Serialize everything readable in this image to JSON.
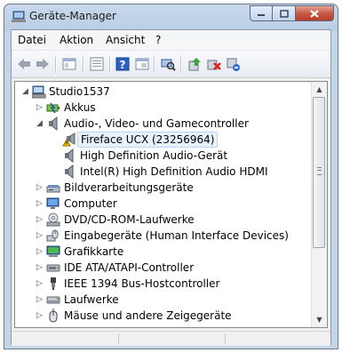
{
  "window": {
    "title": "Geräte-Manager",
    "app_icon": "device-manager-icon"
  },
  "caption_buttons": [
    "minimize-icon",
    "maximize-icon",
    "close-icon"
  ],
  "menu": [
    "Datei",
    "Aktion",
    "Ansicht",
    "?"
  ],
  "toolbar": [
    "back-arrow-icon",
    "forward-arrow-icon",
    "show-hide-console-tree-icon",
    "properties-icon",
    "help-icon",
    "show-hidden-icon",
    "scan-hardware-icon",
    "update-driver-icon",
    "uninstall-icon",
    "disable-icon"
  ],
  "tree": {
    "root": "Studio1537",
    "items": [
      {
        "label": "Akkus",
        "icon": "battery-icon",
        "expanded": false
      },
      {
        "label": "Audio-, Video- und Gamecontroller",
        "icon": "speaker-icon",
        "expanded": true,
        "children": [
          {
            "label": "Fireface UCX (23256964)",
            "icon": "warning-speaker-icon",
            "selected": true
          },
          {
            "label": "High Definition Audio-Gerät",
            "icon": "speaker-icon"
          },
          {
            "label": "Intel(R) High Definition Audio HDMI",
            "icon": "speaker-icon"
          }
        ]
      },
      {
        "label": "Bildverarbeitungsgeräte",
        "icon": "scanner-icon",
        "expanded": false
      },
      {
        "label": "Computer",
        "icon": "computer-icon",
        "expanded": false
      },
      {
        "label": "DVD/CD-ROM-Laufwerke",
        "icon": "disc-drive-icon",
        "expanded": false
      },
      {
        "label": "Eingabegeräte (Human Interface Devices)",
        "icon": "hid-icon",
        "expanded": false
      },
      {
        "label": "Grafikkarte",
        "icon": "display-adapter-icon",
        "expanded": false
      },
      {
        "label": "IDE ATA/ATAPI-Controller",
        "icon": "ide-controller-icon",
        "expanded": false
      },
      {
        "label": "IEEE 1394 Bus-Hostcontroller",
        "icon": "firewire-icon",
        "expanded": false
      },
      {
        "label": "Laufwerke",
        "icon": "disk-drive-icon",
        "expanded": false
      },
      {
        "label": "Mäuse und andere Zeigegeräte",
        "icon": "mouse-icon",
        "expanded": false
      }
    ]
  },
  "colors": {
    "warning": "#f2c200",
    "selection": "#e8f2fc",
    "close_button": "#c75a45"
  }
}
